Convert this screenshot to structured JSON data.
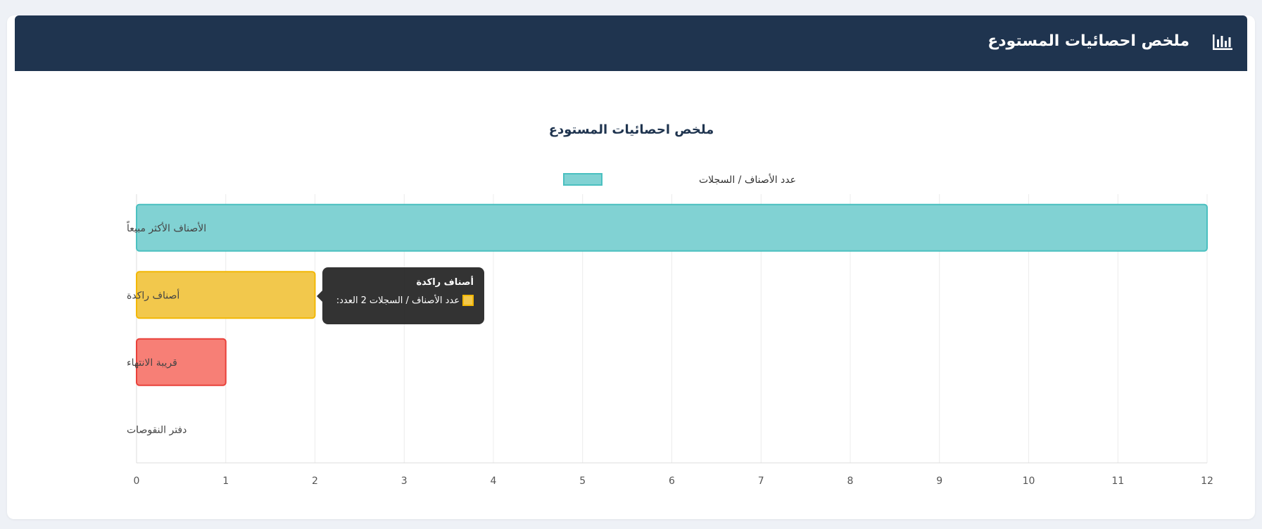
{
  "header": {
    "title": "ملخص احصائيات المستودع",
    "icon": "bar-chart-icon"
  },
  "colors": {
    "header_bg": "#1f344f",
    "page_bg": "#eef1f6"
  },
  "chart_data": {
    "type": "bar",
    "orientation": "horizontal",
    "title": "ملخص احصائيات المستودع",
    "categories": [
      "الأصناف الأكثر مبيعاً",
      "أصناف راكدة",
      "قريبة الانتهاء",
      "دفتر النقوصات"
    ],
    "series": [
      {
        "name": "عدد الأصناف / السجلات",
        "values": [
          12,
          2,
          1,
          0
        ]
      }
    ],
    "bar_colors": [
      {
        "fill": "#81d2d3",
        "stroke": "#4bc0c0"
      },
      {
        "fill": "#f2c84c",
        "stroke": "#f2b705"
      },
      {
        "fill": "#f77f76",
        "stroke": "#e8413a"
      },
      {
        "fill": "#b39ddb",
        "stroke": "#9b7bd0"
      }
    ],
    "xlim": [
      0,
      12
    ],
    "xticks": [
      "0",
      "1",
      "2",
      "3",
      "4",
      "5",
      "6",
      "7",
      "8",
      "9",
      "10",
      "11",
      "12"
    ],
    "grid": true,
    "legend": {
      "position": "top",
      "label": "عدد الأصناف / السجلات",
      "color": "#81d2d3",
      "stroke": "#4bc0c0"
    },
    "tooltip": {
      "title": "أصناف راكدة",
      "value_prefix": "العدد:",
      "value": "2",
      "series_label": "عدد الأصناف / السجلات"
    }
  }
}
